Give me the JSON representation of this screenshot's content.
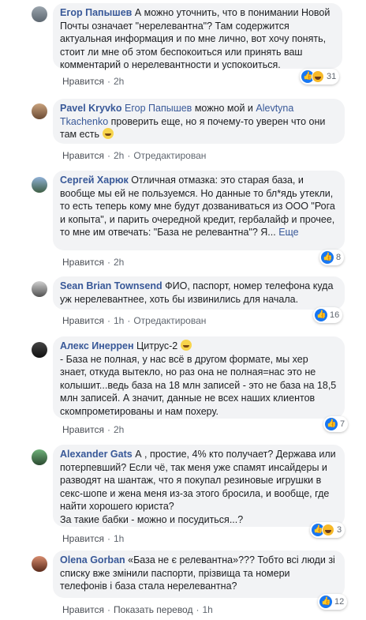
{
  "comments": [
    {
      "author": "Егор Папышев",
      "text": "А можно уточнить, что в понимании Новой Почты означает \"нерелевантна\"? Там содержится актуальная информация и по мне лично, вот хочу понять, стоит ли мне об этом беспокоиться или принять ваш комментарий о нерелевантности и успокоиться.",
      "actions": [
        "Нравится",
        "2h"
      ],
      "reactions": {
        "icons": [
          "like-icon",
          "haha-icon"
        ],
        "count": "31"
      }
    },
    {
      "author": "Pavel Kryvko",
      "mention1": "Егор Папышев",
      "mid": "можно мой и",
      "mention2": "Alevtyna Tkachenko",
      "text": "проверить еще, но я почему-то уверен что они там есть",
      "emoji": "grin-emoji",
      "actions": [
        "Нравится",
        "2h",
        "Отредактирован"
      ]
    },
    {
      "author": "Сергей Харюк",
      "text": "Отличная отмазка: это старая база, и вообще мы ей не пользуемся. Но данные то бл*ядь утекли, то есть теперь кому мне будут дозваниваться из ООО \"Рога и копыта\", и парить очередной кредит, гербалайф и прочее, то мне им отвечать: \"База не релевантна\"? Я...",
      "more": "Еще",
      "actions": [
        "Нравится",
        "2h"
      ],
      "reactions": {
        "icons": [
          "like-icon"
        ],
        "count": "8"
      }
    },
    {
      "author": "Sean Brian Townsend",
      "text": "ФИО, паспорт, номер телефона куда уж нерелевантнее, хоть бы извинились для начала.",
      "actions": [
        "Нравится",
        "1h",
        "Отредактирован"
      ],
      "reactions": {
        "icons": [
          "like-icon"
        ],
        "count": "16"
      }
    },
    {
      "author": "Алекс Инеррен",
      "line1": "Цитрус-2",
      "emoji": "smile-emoji",
      "text": "- База не полная, у нас всё в другом формате, мы хер знает, откуда вытекло, но раз она не полная=нас это не колышит...ведь база на 18 млн записей - это не база на 18,5 млн записей. А значит, данные не всех наших клиентов скомпрометированы и нам похеру.",
      "actions": [
        "Нравится",
        "2h"
      ],
      "reactions": {
        "icons": [
          "like-icon"
        ],
        "count": "7"
      }
    },
    {
      "author": "Alexander Gats",
      "text": "А , простие, 4% кто получает? Держава или потерпевший? Если чё, так меня уже спамят инсайдеры и разводят на шантаж, что я покупал резиновые игрушки в секс-шопе и жена меня из-за этого бросила, и вообще, где найти хорошего юриста?",
      "text2": "За такие бабки - можно и посудиться...?",
      "actions": [
        "Нравится",
        "1h"
      ],
      "reactions": {
        "icons": [
          "like-icon",
          "haha-icon"
        ],
        "count": "3"
      }
    },
    {
      "author": "Olena Gorban",
      "text": "«База не є релевантна»??? Тобто всі люди зі списку вже змінили паспорти, прізвища та номери телефонів і база стала нерелевантна?",
      "actions": [
        "Нравится",
        "Показать перевод",
        "1h"
      ],
      "reactions": {
        "icons": [
          "like-icon"
        ],
        "count": "12"
      }
    }
  ],
  "colors": {
    "link": "#385898",
    "bubble": "#f2f3f5",
    "like": "#1877f2",
    "haha": "#f7b928"
  }
}
